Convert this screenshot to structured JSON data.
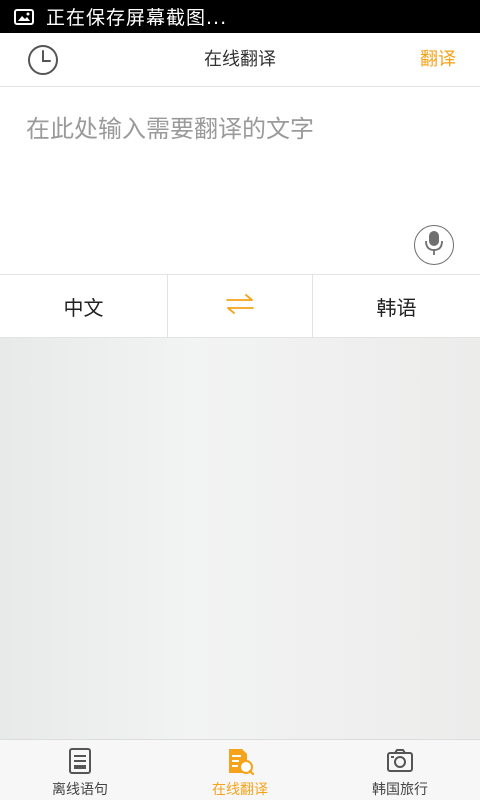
{
  "status_bar": {
    "notification_text": "正在保存屏幕截图...",
    "icon": "image-icon"
  },
  "header": {
    "title": "在线翻译",
    "translate_label": "翻译",
    "history_icon": "clock-icon",
    "accent_color": "#f5a31a"
  },
  "input": {
    "placeholder": "在此处输入需要翻译的文字",
    "value": "",
    "mic_icon": "microphone-icon"
  },
  "language_bar": {
    "source_language": "中文",
    "target_language": "韩语",
    "swap_icon": "swap-arrows-icon"
  },
  "tabs": [
    {
      "label": "离线语句",
      "icon": "phrasebook-icon",
      "active": false
    },
    {
      "label": "在线翻译",
      "icon": "translate-document-icon",
      "active": true
    },
    {
      "label": "韩国旅行",
      "icon": "camera-icon",
      "active": false
    }
  ]
}
